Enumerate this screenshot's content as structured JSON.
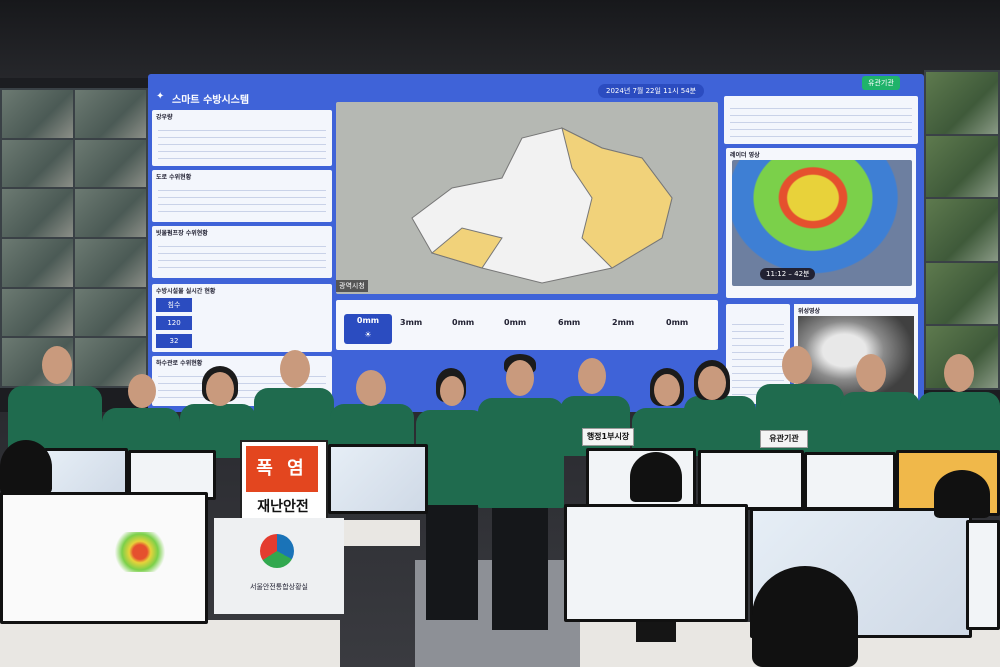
{
  "wall": {
    "system_title": "스마트 수방시스템",
    "clock": "2024년 7월 22일 11시 54분",
    "badge": "유관기관",
    "map_label": "광역시청",
    "panels": [
      {
        "title": "강우량"
      },
      {
        "title": "도로 수위현황"
      },
      {
        "title": "빗물펌프장 수위현황"
      },
      {
        "title": "수방시설물 실시간 현황"
      },
      {
        "title": "하수관로 수위현황"
      }
    ],
    "stat_labels": [
      "침수",
      "120",
      "32"
    ],
    "weather_values": [
      "0mm",
      "3mm",
      "0mm",
      "0mm",
      "6mm",
      "2mm",
      "0mm"
    ],
    "radar_title": "레이더 영상",
    "radar_time": "11:12 – 42분",
    "satellite_title": "위성영상"
  },
  "signs": {
    "red_sign": "폭 염",
    "sub_text": "재난안전",
    "logo_caption": "서울안전통합상황실",
    "card_left": "행정1부시장",
    "card_right": "유관기관"
  },
  "colors": {
    "wall_blue": "#3f63d8",
    "jacket_green": "#1f6b4e",
    "alert_red": "#e3461f"
  }
}
